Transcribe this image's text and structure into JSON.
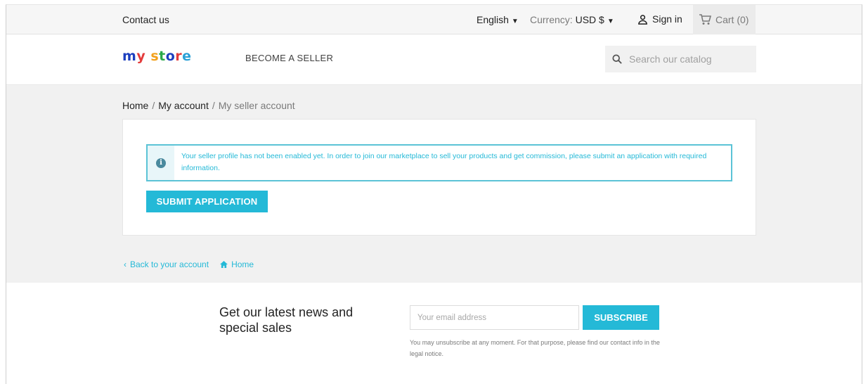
{
  "topbar": {
    "contact": "Contact us",
    "language": "English",
    "currency_label": "Currency:",
    "currency_value": "USD $",
    "sign_in": "Sign in",
    "cart": "Cart (0)"
  },
  "header": {
    "logo_letters": [
      "m",
      "y",
      " ",
      "s",
      "t",
      "o",
      "r",
      "e"
    ],
    "logo_colors": [
      "#1d3fbf",
      "#e33b3b",
      "#ffffff",
      "#f2a01b",
      "#2aa84a",
      "#1d3fbf",
      "#e33b3b",
      "#2aa0d6"
    ],
    "become_seller": "BECOME A SELLER",
    "search_placeholder": "Search our catalog"
  },
  "breadcrumb": {
    "home": "Home",
    "account": "My account",
    "current": "My seller account"
  },
  "alert": {
    "message": "Your seller profile has not been enabled yet. In order to join our marketplace to sell your products and get commission, please submit an application with required information."
  },
  "actions": {
    "submit": "SUBMIT APPLICATION",
    "back": "Back to your account",
    "home": "Home"
  },
  "newsletter": {
    "title": "Get our latest news and special sales",
    "email_placeholder": "Your email address",
    "subscribe": "SUBSCRIBE",
    "conditions": "You may unsubscribe at any moment. For that purpose, please find our contact info in the legal notice."
  },
  "colors": {
    "accent": "#24b9d7",
    "gray_bg": "#f1f1f1"
  }
}
